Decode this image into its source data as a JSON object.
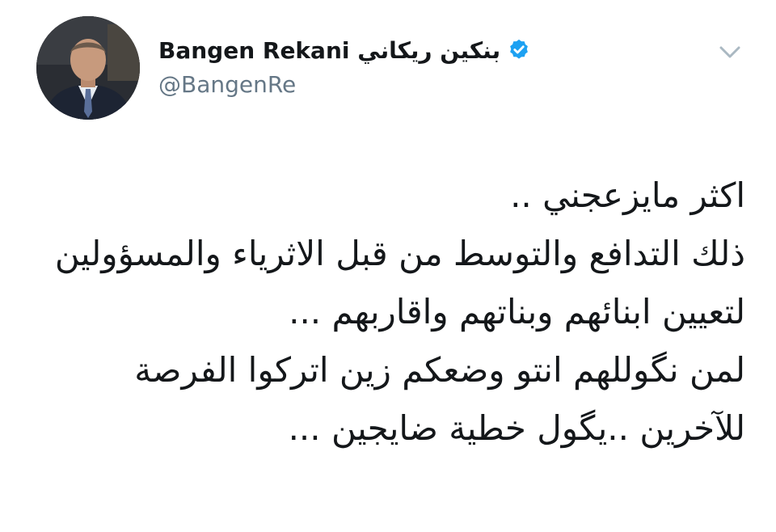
{
  "author": {
    "display_name": "Bangen Rekani بنكين ريكاني",
    "handle": "@BangenRe",
    "verified": true
  },
  "icons": {
    "verified": "verified-badge-icon",
    "caret": "chevron-down-icon"
  },
  "colors": {
    "verified_blue": "#1da1f2",
    "name": "#14171a",
    "handle": "#657786",
    "caret": "#aab8c2"
  },
  "tweet": {
    "lines": [
      "اكثر مايزعجني ..",
      "ذلك التدافع والتوسط من قبل الاثرياء والمسؤولين",
      "لتعيين ابنائهم وبناتهم واقاربهم ...",
      "لمن نگوللهم انتو وضعكم زين اتركوا الفرصة",
      "للآخرين ..يگول خطية ضايجين ..."
    ]
  }
}
